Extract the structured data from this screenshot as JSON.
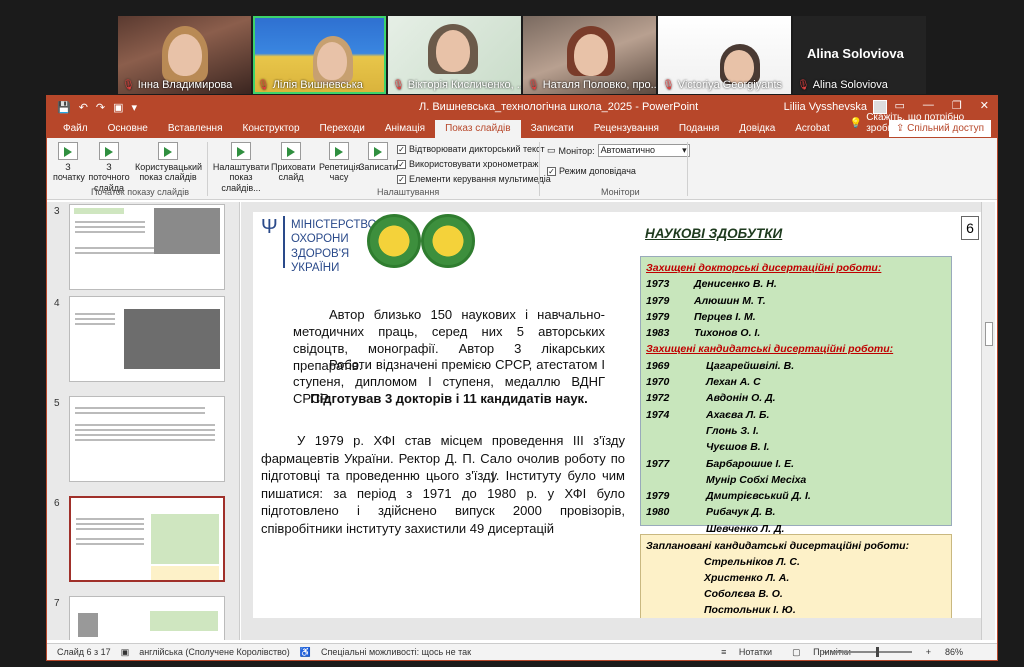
{
  "participants": [
    {
      "name": "Інна Владимирова"
    },
    {
      "name": "Лілія Вишневська"
    },
    {
      "name": "Вікторія Кисличенко, ..."
    },
    {
      "name": "Наталя Половко, про..."
    },
    {
      "name": "Victoriya Georgiyants"
    },
    {
      "name": "Alina Soloviova",
      "display": "Alina Soloviova"
    }
  ],
  "window": {
    "title": "Л. Вишневська_технологічна школа_2025  -  PowerPoint",
    "user": "Liliia Vysshevska",
    "controls": {
      "ribbon_display": "▭",
      "minimize": "—",
      "restore": "❐",
      "close": "✕"
    }
  },
  "tabs": [
    "Файл",
    "Основне",
    "Вставлення",
    "Конструктор",
    "Переходи",
    "Анімація",
    "Показ слайдів",
    "Записати",
    "Рецензування",
    "Подання",
    "Довідка",
    "Acrobat"
  ],
  "active_tab": "Показ слайдів",
  "tell_me": "Скажіть, що потрібно зробити",
  "share": "Спільний доступ",
  "ribbon": {
    "from_start": "З початку",
    "from_current": "З поточного слайда",
    "custom_show": "Користувацький показ слайдів",
    "group_start": "Початок показу слайдів",
    "setup_show": "Налаштувати показ слайдів...",
    "hide_slide": "Приховати слайд",
    "rehearse": "Репетиція часу",
    "record": "Записати",
    "group_setup": "Налаштування",
    "chk_narration": "Відтворювати дикторський текст",
    "chk_timings": "Використовувати хронометраж",
    "chk_media": "Елементи керування мультимедіа",
    "monitor_label": "Монітор:",
    "monitor_value": "Автоматично",
    "presenter_view": "Режим доповідача",
    "group_monitors": "Монітори"
  },
  "thumbnails": [
    "3",
    "4",
    "5",
    "6",
    "7"
  ],
  "slide": {
    "ministry": [
      "МІНІСТЕРСТВО",
      "ОХОРОНИ",
      "ЗДОРОВ'Я",
      "УКРАЇНИ"
    ],
    "page": "6",
    "heading": "НАУКОВІ ЗДОБУТКИ",
    "p1": "Автор близько 150 наукових і навчально-методичних праць, серед них 5 авторських свідоцтв, монографії. Автор 3 лікарських препаратів.",
    "p2": "Роботи відзначені премією СРСР, атестатом I ступеня, дипломом I ступеня, медаллю ВДНГ СРСР.",
    "p3": "Підготував 3 докторів і 11 кандидатів наук.",
    "p4": "У 1979 р. ХФІ став місцем проведення III з'їзду фармацевтів України. Ректор Д. П. Сало очолив роботу по підготовці та проведенню цього з'їзду. Інституту було чим пишатися: за період з 1971 до 1980 р. у ХФІ було підготовлено і здійснено випуск 2000 провізорів, співробітники інституту захистили 49 дисертацій",
    "doctor_title": "Захищені докторські дисертаційні роботи:",
    "doctors": [
      {
        "year": "1973",
        "name": "Денисенко В. Н."
      },
      {
        "year": "1979",
        "name": "Алюшин М. Т."
      },
      {
        "year": "1979",
        "name": "Перцев І. М."
      },
      {
        "year": "1983",
        "name": "Тихонов О. І."
      }
    ],
    "cand_title": "Захищені кандидатські дисертаційні роботи:",
    "candidates": [
      {
        "year": "1969",
        "name": "Цагарейшвілі. В."
      },
      {
        "year": "1970",
        "name": "Лехан А. С"
      },
      {
        "year": "1972",
        "name": "Авдонін О. Д."
      },
      {
        "year": "1974",
        "name": "Ахаєва Л. Б."
      },
      {
        "year": "",
        "name": "Глонь З. І."
      },
      {
        "year": "",
        "name": "Чуєшов В. І."
      },
      {
        "year": "1977",
        "name": "Барбарошие І. Е."
      },
      {
        "year": "",
        "name": "Мунір Собхі Месіха"
      },
      {
        "year": "1979",
        "name": "Дмитрієвський Д. І."
      },
      {
        "year": "1980",
        "name": "Рибачук Д. В."
      },
      {
        "year": "",
        "name": "Шевченко Л. Д."
      }
    ],
    "planned_title": "Заплановані кандидатські дисертаційні роботи:",
    "planned": [
      "Стрельніков Л. С.",
      "Христенко Л. А.",
      "Соболєва В. О.",
      "Постольник  І. Ю."
    ]
  },
  "status": {
    "slide": "Слайд 6 з 17",
    "lang": "англійська (Сполучене Королівство)",
    "access": "Спеціальні можливості: щось не так",
    "notes": "Нотатки",
    "comments": "Примітки",
    "zoom": "86%"
  }
}
